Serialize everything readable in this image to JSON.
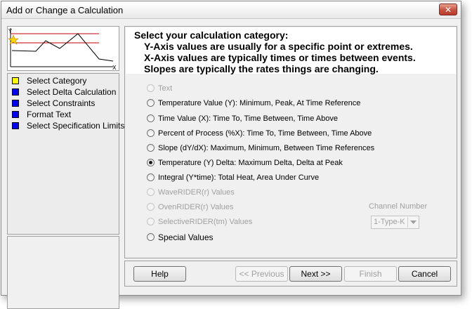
{
  "window": {
    "title": "Add or Change a Calculation"
  },
  "preview": {
    "y_label": "Y",
    "x_label": "X"
  },
  "steps": [
    {
      "label": "Select Category",
      "color": "#ffff00"
    },
    {
      "label": "Select Delta Calculation",
      "color": "#0000ff"
    },
    {
      "label": "Select Constraints",
      "color": "#0000ff"
    },
    {
      "label": "Format Text",
      "color": "#0000ff"
    },
    {
      "label": "Select Specification Limits",
      "color": "#0000ff"
    }
  ],
  "heading": {
    "line1": "Select your calculation category:",
    "line2": "Y-Axis values are usually for a specific point or extremes.",
    "line3": "X-Axis values are typically times or times between events.",
    "line4": "Slopes are typically the rates things are changing."
  },
  "options": [
    {
      "label": "Text",
      "enabled": false,
      "checked": false
    },
    {
      "label": "Temperature Value (Y):  Minimum, Peak, At Time Reference",
      "enabled": true,
      "checked": false
    },
    {
      "label": "Time Value (X):  Time To, Time Between, Time Above",
      "enabled": true,
      "checked": false
    },
    {
      "label": "Percent of Process (%X):  Time To, Time Between, Time Above",
      "enabled": true,
      "checked": false
    },
    {
      "label": "Slope (dY/dX):  Maximum, Minimum, Between Time References",
      "enabled": true,
      "checked": false
    },
    {
      "label": "Temperature (Y) Delta:  Maximum Delta, Delta at Peak",
      "enabled": true,
      "checked": true
    },
    {
      "label": "Integral (Y*time): Total Heat, Area Under Curve",
      "enabled": true,
      "checked": false
    },
    {
      "label": "WaveRIDER(r) Values",
      "enabled": false,
      "checked": false
    },
    {
      "label": "OvenRIDER(r) Values",
      "enabled": false,
      "checked": false
    },
    {
      "label": "SelectiveRIDER(tm) Values",
      "enabled": false,
      "checked": false
    },
    {
      "label": "Special  Values",
      "enabled": true,
      "checked": false
    }
  ],
  "channel": {
    "label": "Channel Number",
    "value": "1-Type-K"
  },
  "buttons": {
    "help": "Help",
    "previous": "<< Previous",
    "next": "Next >>",
    "finish": "Finish",
    "cancel": "Cancel"
  }
}
